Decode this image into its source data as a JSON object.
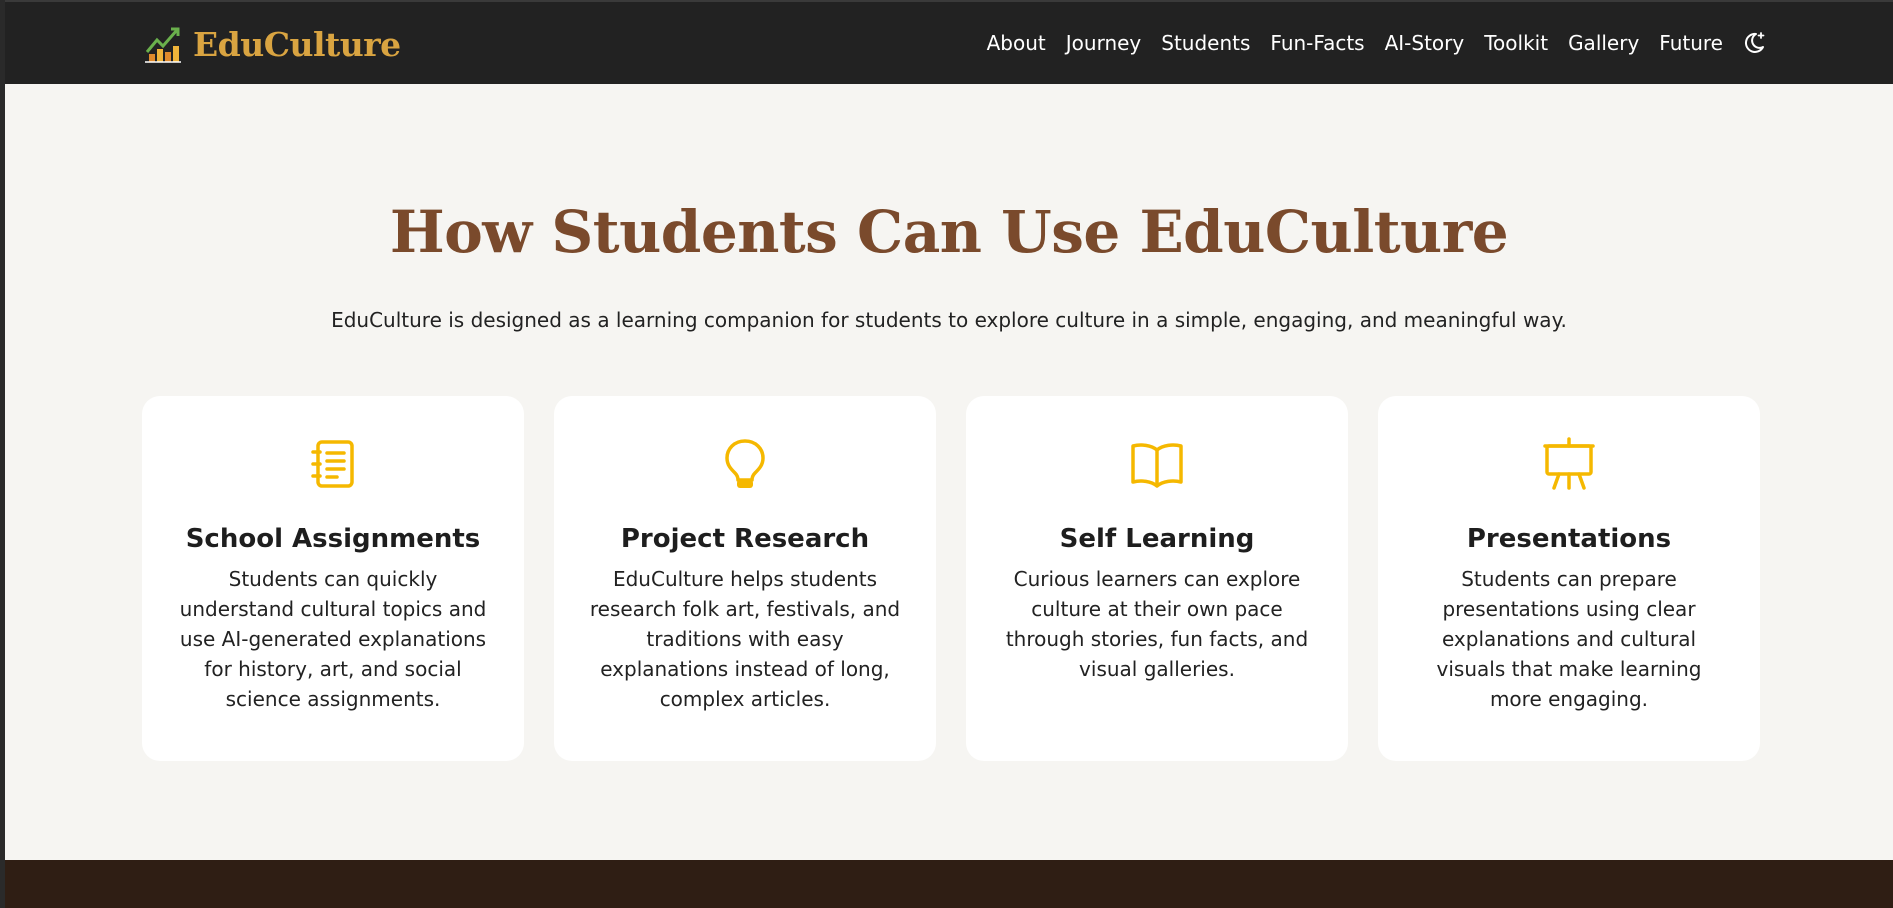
{
  "brand": {
    "name": "EduCulture",
    "logo_icon": "chart-trend-icon",
    "name_color": "#d9a441"
  },
  "nav": {
    "links": [
      "About",
      "Journey",
      "Students",
      "Fun-Facts",
      "AI-Story",
      "Toolkit",
      "Gallery",
      "Future"
    ],
    "theme_toggle_icon": "moon-star-icon"
  },
  "section": {
    "title": "How Students Can Use EduCulture",
    "subtitle": "EduCulture is designed as a learning companion for students to explore culture in a simple, engaging, and meaningful way."
  },
  "cards": [
    {
      "icon": "notebook-icon",
      "title": "School Assignments",
      "text": "Students can quickly understand cultural topics and use AI-generated explanations for history, art, and social science assignments."
    },
    {
      "icon": "lightbulb-icon",
      "title": "Project Research",
      "text": "EduCulture helps students research folk art, festivals, and traditions with easy explanations instead of long, complex articles."
    },
    {
      "icon": "open-book-icon",
      "title": "Self Learning",
      "text": "Curious learners can explore culture at their own pace through stories, fun facts, and visual galleries."
    },
    {
      "icon": "easel-icon",
      "title": "Presentations",
      "text": "Students can prepare presentations using clear explanations and cultural visuals that make learning more engaging."
    }
  ],
  "colors": {
    "navbar_bg": "#222222",
    "page_bg": "#f6f5f2",
    "title": "#7a4a2c",
    "icon_accent": "#f5b800",
    "footer_bg": "#2f1e14"
  }
}
